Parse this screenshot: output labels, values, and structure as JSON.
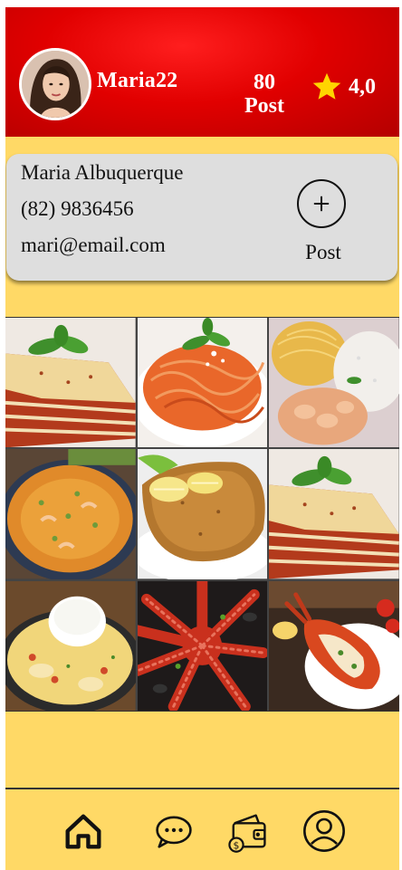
{
  "header": {
    "username": "Maria22",
    "posts_count": "80",
    "posts_label": "Post",
    "rating": "4,0"
  },
  "profile": {
    "name": "Maria Albuquerque",
    "phone": "(82) 9836456",
    "email": "mari@email.com",
    "add_post_label": "Post"
  },
  "grid": {
    "photos": [
      {
        "icon": "lasagna-photo"
      },
      {
        "icon": "spaghetti-photo"
      },
      {
        "icon": "noodles-shrimp-rice-photo"
      },
      {
        "icon": "shrimp-stew-photo"
      },
      {
        "icon": "breaded-cutlet-photo"
      },
      {
        "icon": "lasagna-photo"
      },
      {
        "icon": "rice-fish-stew-photo"
      },
      {
        "icon": "octopus-photo"
      },
      {
        "icon": "lobster-photo"
      }
    ]
  },
  "nav": {
    "items": [
      {
        "icon": "home-icon"
      },
      {
        "icon": "chat-icon"
      },
      {
        "icon": "wallet-icon"
      },
      {
        "icon": "profile-icon"
      }
    ]
  },
  "colors": {
    "header_red": "#e10000",
    "background_yellow": "#ffd966",
    "card_gray": "#dedede",
    "star_yellow": "#ffd400"
  }
}
